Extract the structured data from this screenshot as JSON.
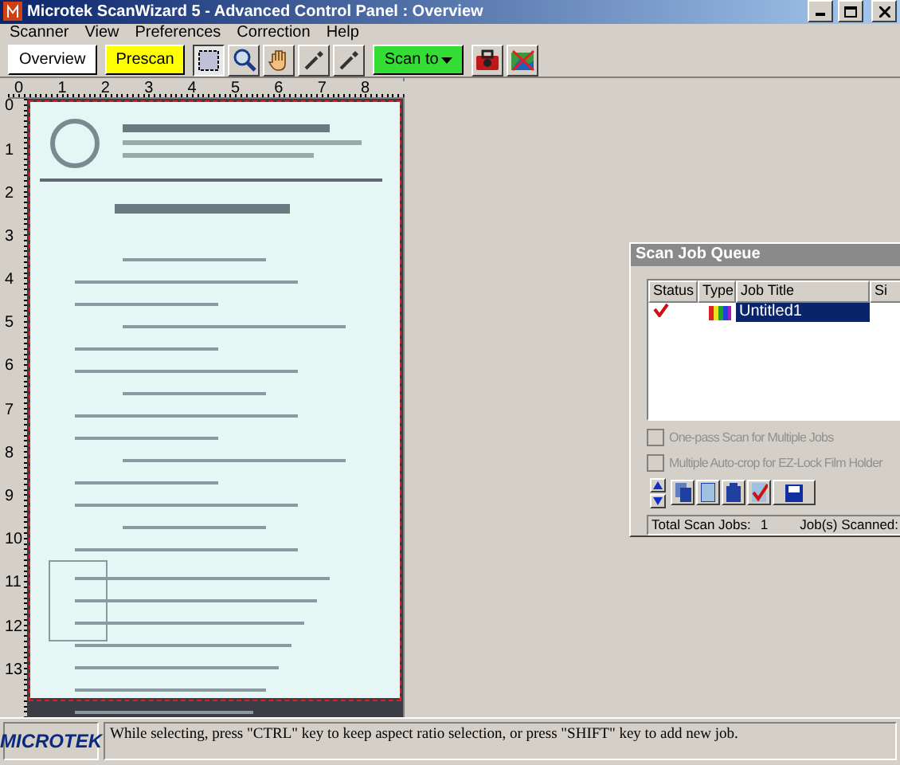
{
  "window": {
    "title": "Microtek ScanWizard 5 - Advanced Control Panel : Overview"
  },
  "menu": [
    "Scanner",
    "View",
    "Preferences",
    "Correction",
    "Help"
  ],
  "toolbar": [
    {
      "kind": "text",
      "label": "Overview",
      "color": "#ffffff"
    },
    {
      "kind": "text",
      "label": "Prescan",
      "color": "#ffff00"
    },
    {
      "kind": "icon",
      "selected": true
    },
    {
      "kind": "icon",
      "selected": false
    },
    {
      "kind": "icon",
      "selected": false
    },
    {
      "kind": "icon",
      "selected": false
    },
    {
      "kind": "icon",
      "selected": false
    },
    {
      "kind": "menu",
      "label": "Scan to",
      "color": "#33dd33"
    },
    {
      "kind": "icon",
      "selected": false
    },
    {
      "kind": "icon",
      "selected": false
    }
  ],
  "horizontal_ruler": [
    "0",
    "1",
    "2",
    "3",
    "4",
    "5",
    "6",
    "7",
    "8"
  ],
  "vertical_ruler": [
    "0",
    "1",
    "2",
    "3",
    "4",
    "5",
    "6",
    "7",
    "8",
    "9",
    "10",
    "11",
    "12",
    "13"
  ],
  "preview": {
    "kind": "picture"
  },
  "scan_job_queue": {
    "title": "Scan Job Queue",
    "columns": [
      "Status",
      "Type",
      "Job Title",
      "Si"
    ],
    "rows": [
      {
        "checked": true,
        "job_title": "Untitled1",
        "selected": true
      }
    ],
    "options": [
      {
        "label": "One-pass Scan for Multiple Jobs",
        "checked": false,
        "disabled": true
      },
      {
        "label": "Multiple Auto-crop for EZ-Lock Film Holder",
        "checked": false,
        "disabled": true
      }
    ],
    "total_label": "Total Scan Jobs:",
    "total": "1",
    "scanned_label": "Job(s) Scanned:"
  },
  "status_bar": {
    "logo": "MICROTEK",
    "message": "While selecting, press \"CTRL\" key to keep aspect ratio selection, or press \"SHIFT\" key to add new job."
  }
}
